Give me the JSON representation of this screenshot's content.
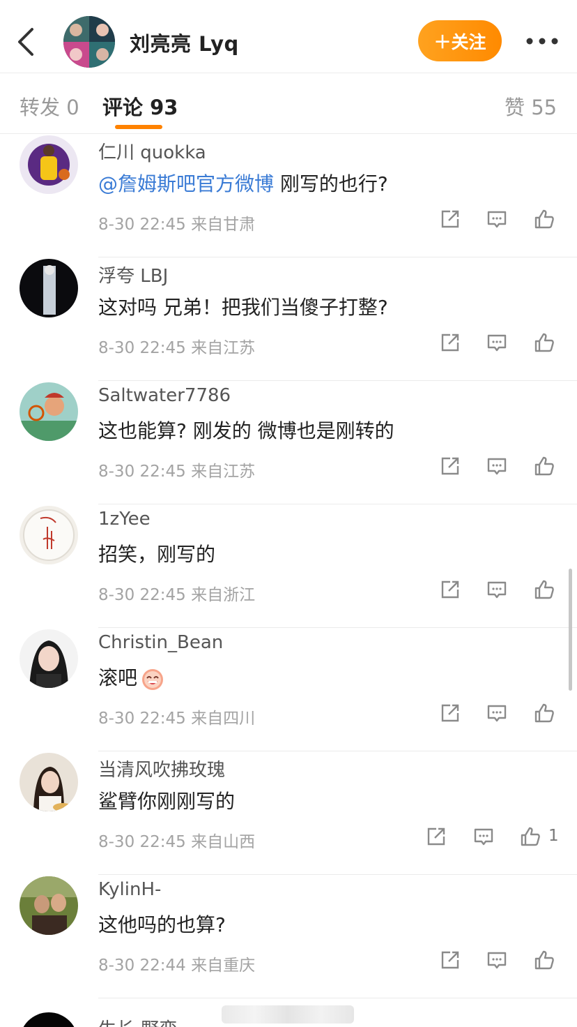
{
  "header": {
    "title": "刘亮亮 Lyq",
    "follow_label": "＋关注",
    "accent_color": "#ff8200"
  },
  "tabs": [
    {
      "label": "转发 0"
    },
    {
      "label": "评论 93"
    },
    {
      "label": "赞 55"
    }
  ],
  "comments": [
    {
      "user": "仁川 quokka",
      "mention": "@詹姆斯吧官方微博",
      "text": " 刚写的也行?",
      "time": "8-30 22:45",
      "location": "来自甘肃",
      "likes": ""
    },
    {
      "user": "浮夸 LBJ",
      "mention": "",
      "text": "这对吗 兄弟！把我们当傻子打整?",
      "time": "8-30 22:45",
      "location": "来自江苏",
      "likes": ""
    },
    {
      "user": "Saltwater7786",
      "mention": "",
      "text": "这也能算? 刚发的 微博也是刚转的",
      "time": "8-30 22:45",
      "location": "来自江苏",
      "likes": ""
    },
    {
      "user": "1zYee",
      "mention": "",
      "text": "招笑，刚写的",
      "time": "8-30 22:45",
      "location": "来自浙江",
      "likes": ""
    },
    {
      "user": "Christin_Bean",
      "mention": "",
      "text": "滚吧",
      "time": "8-30 22:45",
      "location": "来自四川",
      "likes": ""
    },
    {
      "user": "当清风吹拂玫瑰",
      "mention": "",
      "text": "鲨臂你刚刚写的",
      "time": "8-30 22:45",
      "location": "来自山西",
      "likes": "1"
    },
    {
      "user": "KylinH-",
      "mention": "",
      "text": "这他吗的也算?",
      "time": "8-30 22:44",
      "location": "来自重庆",
      "likes": ""
    },
    {
      "user": "生长-野蛮",
      "mention": "",
      "text": "",
      "time": "",
      "location": "",
      "likes": ""
    }
  ]
}
